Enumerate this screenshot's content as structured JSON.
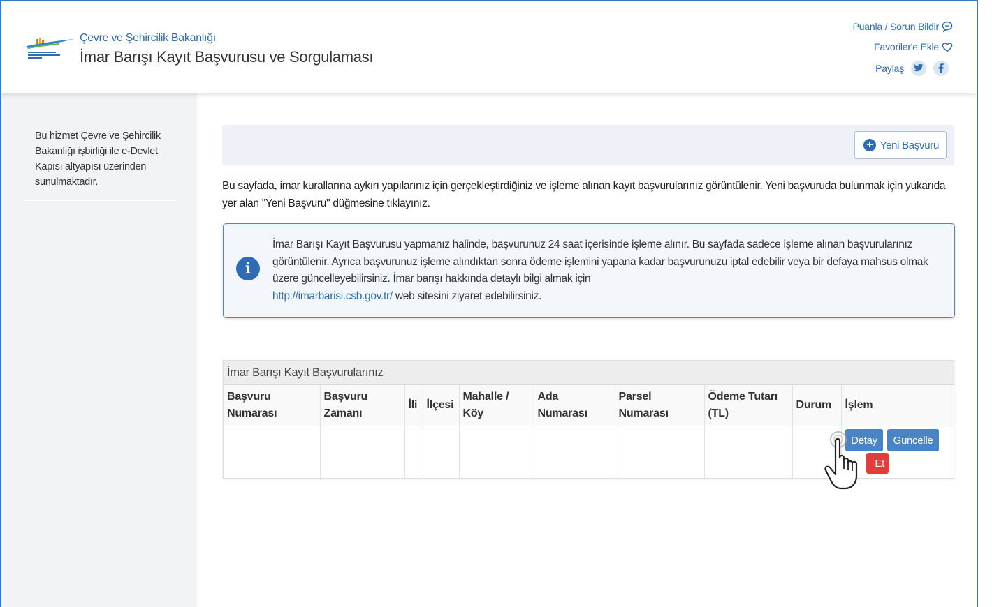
{
  "header": {
    "ministry": "Çevre ve Şehircilik Bakanlığı",
    "service_title": "İmar Barışı Kayıt Başvurusu ve Sorgulaması",
    "rate_link": "Puanla / Sorun Bildir",
    "favorites_link": "Favoriler'e Ekle",
    "share_label": "Paylaş",
    "icons": [
      "comment-icon",
      "heart-icon",
      "twitter-icon",
      "facebook-icon"
    ]
  },
  "sidebar": {
    "info_text": "Bu hizmet Çevre ve Şehircilik Bakanlığı işbirliği ile e-Devlet Kapısı altyapısı üzerinden sunulmaktadır."
  },
  "toolbar": {
    "new_application_label": "Yeni Başvuru"
  },
  "main": {
    "intro": "Bu sayfada, imar kurallarına aykırı yapılarınız için gerçekleştirdiğiniz ve işleme alınan kayıt başvurularınız görüntülenir. Yeni başvuruda bulunmak için yukarıda yer alan \"Yeni Başvuru\" düğmesine tıklayınız."
  },
  "alert": {
    "text": "İmar Barışı Kayıt Başvurusu yapmanız halinde, başvurunuz 24 saat içerisinde işleme alınır. Bu sayfada sadece işleme alınan başvurularınız görüntülenir. Ayrıca başvurunuz işleme alındıktan sonra ödeme işlemini yapana kadar başvurunuzu iptal edebilir veya bir defaya mahsus olmak üzere güncelleyebilirsiniz. İmar barışı hakkında detaylı bilgi almak için",
    "link": "http://imarbarisi.csb.gov.tr/",
    "suffix": " web sitesini ziyaret edebilirsiniz."
  },
  "table": {
    "title": "İmar Barışı Kayıt Başvurularınız",
    "columns": [
      "Başvuru Numarası",
      "Başvuru Zamanı",
      "İli",
      "İlçesi",
      "Mahalle / Köy",
      "Ada Numarası",
      "Parsel Numarası",
      "Ödeme Tutarı (TL)",
      "Durum",
      "İşlem"
    ],
    "actions": {
      "detail": "Detay",
      "update": "Güncelle",
      "cancel_partial": "Et"
    }
  },
  "colors": {
    "accent": "#2e6db4",
    "button_blue": "#4a84c4",
    "danger": "#e23c3c",
    "sidebar_bg": "#f1f3f5"
  }
}
